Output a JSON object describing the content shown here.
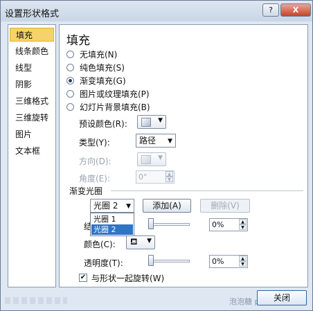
{
  "window": {
    "title": "设置形状格式",
    "help_label": "?",
    "close_label": "X"
  },
  "nav": {
    "items": [
      {
        "label": "填充",
        "selected": true
      },
      {
        "label": "线条颜色",
        "selected": false
      },
      {
        "label": "线型",
        "selected": false
      },
      {
        "label": "阴影",
        "selected": false
      },
      {
        "label": "三维格式",
        "selected": false
      },
      {
        "label": "三维旋转",
        "selected": false
      },
      {
        "label": "图片",
        "selected": false
      },
      {
        "label": "文本框",
        "selected": false
      }
    ]
  },
  "fill": {
    "heading": "填充",
    "options": [
      {
        "label": "无填充(N)",
        "checked": false
      },
      {
        "label": "纯色填充(S)",
        "checked": false
      },
      {
        "label": "渐变填充(G)",
        "checked": true
      },
      {
        "label": "图片或纹理填充(P)",
        "checked": false
      },
      {
        "label": "幻灯片背景填充(B)",
        "checked": false
      }
    ],
    "preset_colors_label": "预设颜色(R):",
    "type_label": "类型(Y):",
    "type_value": "路径",
    "direction_label": "方向(D):",
    "angle_label": "角度(E):",
    "angle_value": "0°",
    "gradient_stops_label": "渐变光圈",
    "stop_selected": "光圈 2",
    "add_label": "添加(A)",
    "remove_label": "删除(V)",
    "stop_list": [
      {
        "label": "光圈 1",
        "selected": false
      },
      {
        "label": "光圈 2",
        "selected": true
      }
    ],
    "position_label_partial": "结",
    "position_value": "0%",
    "color_label": "颜色(C):",
    "transparency_label": "透明度(T):",
    "transparency_value": "0%",
    "rotate_with_shape_label": "与形状一起旋转(W)",
    "rotate_with_shape_checked": true
  },
  "footer": {
    "close_label": "关闭",
    "watermark": "泡泡糖 pptcn"
  }
}
